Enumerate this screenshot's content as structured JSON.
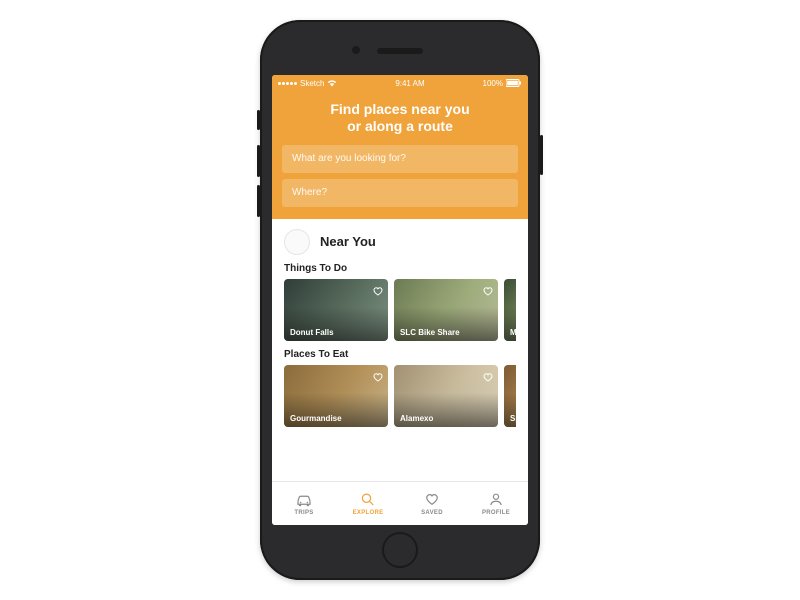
{
  "status_bar": {
    "carrier": "Sketch",
    "time": "9:41 AM",
    "battery": "100%"
  },
  "header": {
    "title_line1": "Find places near you",
    "title_line2": "or along a route"
  },
  "search": {
    "what_placeholder": "What are you looking for?",
    "where_placeholder": "Where?"
  },
  "near_you_label": "Near You",
  "sections": {
    "things": {
      "title": "Things To Do",
      "cards": [
        {
          "title": "Donut Falls"
        },
        {
          "title": "SLC Bike Share"
        },
        {
          "title": "M"
        }
      ]
    },
    "eat": {
      "title": "Places To Eat",
      "cards": [
        {
          "title": "Gourmandise"
        },
        {
          "title": "Alamexo"
        },
        {
          "title": "Sp"
        }
      ]
    }
  },
  "tabs": {
    "trips": "TRIPS",
    "explore": "EXPLORE",
    "saved": "SAVED",
    "profile": "PROFILE"
  },
  "colors": {
    "accent": "#efa33a"
  }
}
